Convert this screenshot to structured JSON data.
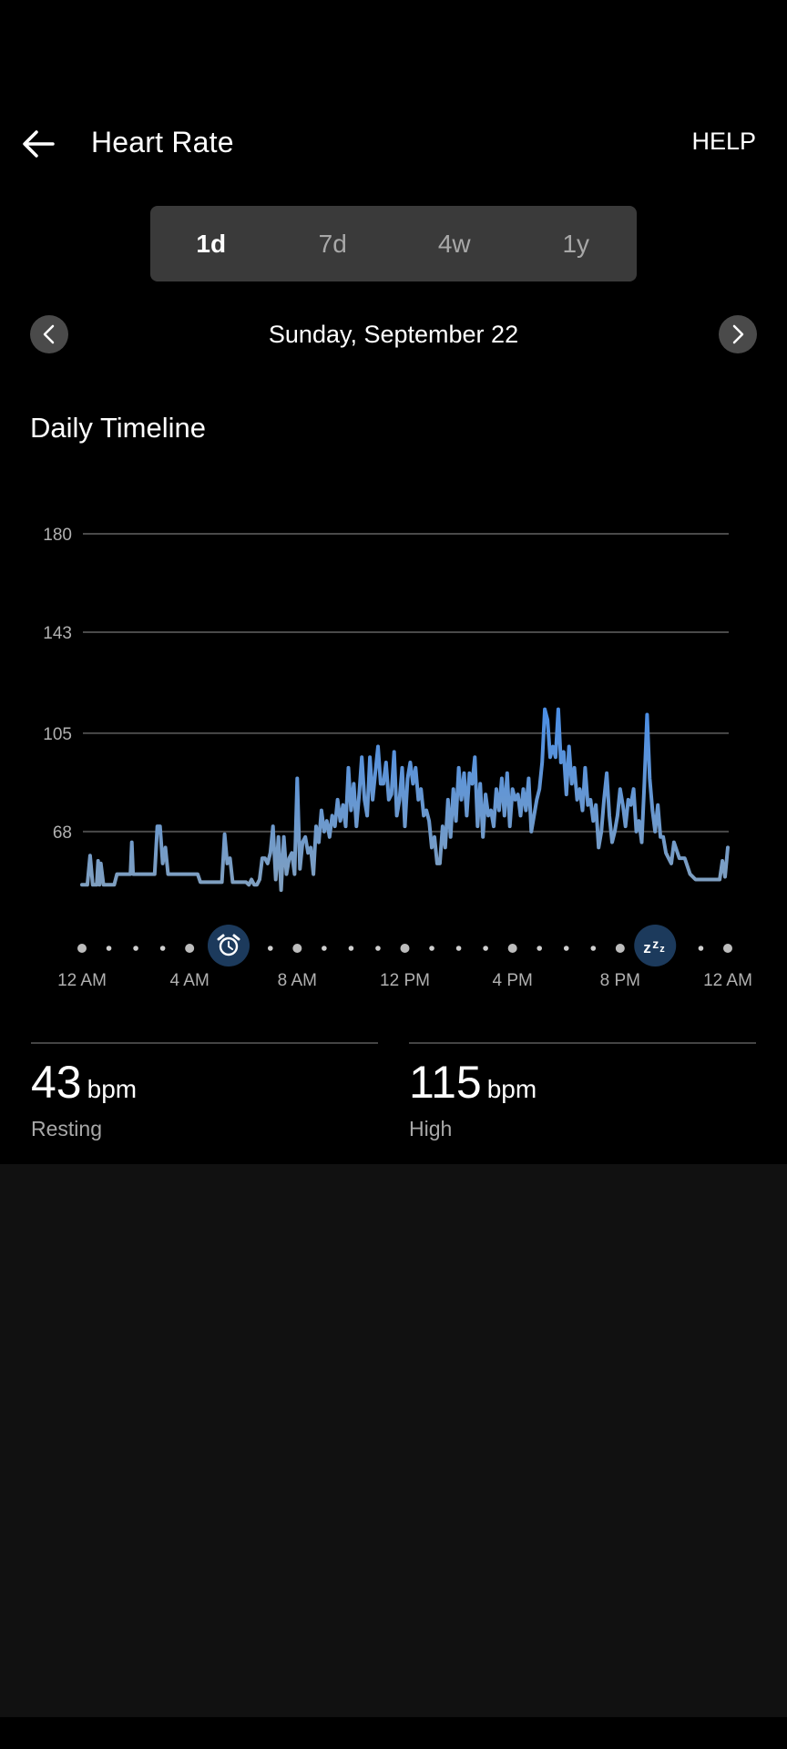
{
  "header": {
    "title": "Heart Rate",
    "help_label": "HELP",
    "back_icon": "arrow-left-icon"
  },
  "range_tabs": [
    {
      "label": "1d",
      "active": true
    },
    {
      "label": "7d",
      "active": false
    },
    {
      "label": "4w",
      "active": false
    },
    {
      "label": "1y",
      "active": false
    }
  ],
  "date_nav": {
    "date": "Sunday, September 22",
    "prev_icon": "chevron-left-icon",
    "next_icon": "chevron-right-icon"
  },
  "section_title": "Daily Timeline",
  "colors": {
    "line_top": "#4a8ee6",
    "line_bottom": "#7f9fc0",
    "grid": "#4a4a4a",
    "marker_bg": "#1c3a5c"
  },
  "chart_data": {
    "type": "line",
    "title": "Daily Timeline",
    "xlabel": "",
    "ylabel": "bpm",
    "ylim": [
      48,
      180
    ],
    "yticks": [
      180,
      143,
      105,
      68
    ],
    "xlim": [
      0,
      24
    ],
    "xtick_labels": [
      "12 AM",
      "4 AM",
      "8 AM",
      "12 PM",
      "4 PM",
      "8 PM",
      "12 AM"
    ],
    "xtick_hours": [
      0,
      4,
      8,
      12,
      16,
      20,
      24
    ],
    "grid": true,
    "markers": [
      {
        "icon": "alarm-clock-icon",
        "label": "wake",
        "hour": 5.45
      },
      {
        "icon": "sleep-zzz-icon",
        "label": "sleep",
        "hour": 21.3
      }
    ],
    "series": [
      {
        "name": "Heart Rate",
        "x": [
          0,
          0.1,
          0.2,
          0.3,
          0.4,
          0.5,
          0.55,
          0.6,
          0.65,
          0.7,
          0.8,
          0.9,
          1.0,
          1.05,
          1.1,
          1.2,
          1.3,
          1.4,
          1.5,
          1.6,
          1.7,
          1.8,
          1.85,
          1.9,
          2.0,
          2.1,
          2.2,
          2.3,
          2.5,
          2.6,
          2.65,
          2.7,
          2.8,
          2.9,
          3.0,
          3.1,
          3.2,
          3.3,
          3.4,
          3.5,
          3.7,
          3.8,
          3.9,
          4.0,
          4.1,
          4.2,
          4.3,
          4.4,
          4.5,
          4.6,
          4.7,
          4.8,
          4.9,
          5.0,
          5.1,
          5.2,
          5.3,
          5.4,
          5.5,
          5.6,
          5.7,
          5.8,
          5.9,
          6.0,
          6.1,
          6.2,
          6.3,
          6.4,
          6.5,
          6.6,
          6.7,
          6.8,
          6.9,
          7.0,
          7.1,
          7.2,
          7.3,
          7.4,
          7.5,
          7.6,
          7.7,
          7.8,
          7.9,
          8.0,
          8.1,
          8.2,
          8.3,
          8.4,
          8.5,
          8.6,
          8.7,
          8.8,
          8.9,
          9.0,
          9.1,
          9.2,
          9.3,
          9.4,
          9.5,
          9.6,
          9.7,
          9.8,
          9.9,
          10.0,
          10.1,
          10.2,
          10.3,
          10.4,
          10.5,
          10.6,
          10.7,
          10.8,
          10.9,
          11.0,
          11.1,
          11.2,
          11.3,
          11.4,
          11.5,
          11.6,
          11.7,
          11.8,
          11.9,
          12.0,
          12.1,
          12.2,
          12.3,
          12.4,
          12.5,
          12.6,
          12.7,
          12.8,
          12.9,
          13.0,
          13.1,
          13.2,
          13.3,
          13.4,
          13.5,
          13.6,
          13.7,
          13.8,
          13.9,
          14.0,
          14.1,
          14.2,
          14.3,
          14.4,
          14.5,
          14.6,
          14.7,
          14.8,
          14.9,
          15.0,
          15.1,
          15.2,
          15.3,
          15.4,
          15.5,
          15.6,
          15.7,
          15.8,
          15.9,
          16.0,
          16.1,
          16.2,
          16.3,
          16.4,
          16.5,
          16.6,
          16.7,
          16.8,
          16.9,
          17.0,
          17.1,
          17.2,
          17.3,
          17.4,
          17.5,
          17.6,
          17.7,
          17.8,
          17.9,
          18.0,
          18.1,
          18.2,
          18.3,
          18.4,
          18.5,
          18.6,
          18.7,
          18.8,
          18.9,
          19.0,
          19.1,
          19.2,
          19.3,
          19.4,
          19.5,
          19.6,
          19.7,
          19.8,
          19.9,
          20.0,
          20.1,
          20.2,
          20.3,
          20.4,
          20.5,
          20.6,
          20.7,
          20.8,
          20.9,
          21.0,
          21.1,
          21.2,
          21.3,
          21.4,
          21.5,
          21.6,
          21.7,
          21.8,
          21.9,
          22.0,
          22.2,
          22.4,
          22.6,
          22.8,
          23.0,
          23.2,
          23.3,
          23.4,
          23.5,
          23.6,
          23.7,
          23.8,
          23.9,
          24.0
        ],
        "y": [
          48,
          48,
          48,
          59,
          48,
          48,
          48,
          57,
          48,
          56,
          48,
          48,
          48,
          48,
          48,
          48,
          52,
          52,
          52,
          52,
          52,
          52,
          64,
          52,
          52,
          52,
          52,
          52,
          52,
          52,
          52,
          52,
          70,
          70,
          56,
          62,
          52,
          52,
          52,
          52,
          52,
          52,
          52,
          52,
          52,
          52,
          52,
          49,
          49,
          49,
          49,
          49,
          49,
          49,
          49,
          49,
          67,
          56,
          58,
          49,
          49,
          49,
          49,
          49,
          49,
          48,
          50,
          48,
          48,
          50,
          58,
          58,
          56,
          60,
          70,
          50,
          66,
          46,
          66,
          52,
          58,
          60,
          52,
          88,
          54,
          64,
          66,
          60,
          62,
          52,
          70,
          64,
          76,
          68,
          72,
          66,
          74,
          70,
          80,
          72,
          78,
          70,
          92,
          76,
          86,
          70,
          82,
          96,
          80,
          74,
          96,
          80,
          90,
          100,
          86,
          86,
          94,
          80,
          82,
          98,
          74,
          80,
          92,
          70,
          88,
          94,
          86,
          92,
          80,
          84,
          74,
          76,
          72,
          62,
          66,
          56,
          56,
          70,
          62,
          80,
          66,
          84,
          72,
          92,
          80,
          90,
          74,
          90,
          86,
          96,
          70,
          86,
          66,
          82,
          74,
          76,
          70,
          84,
          76,
          88,
          74,
          90,
          70,
          84,
          80,
          82,
          74,
          84,
          76,
          88,
          68,
          74,
          80,
          84,
          94,
          114,
          110,
          96,
          100,
          96,
          114,
          94,
          98,
          82,
          100,
          86,
          92,
          80,
          84,
          76,
          92,
          78,
          80,
          72,
          78,
          62,
          68,
          80,
          90,
          74,
          64,
          68,
          74,
          84,
          78,
          70,
          80,
          78,
          84,
          68,
          72,
          64,
          86,
          112,
          88,
          76,
          68,
          78,
          66,
          66,
          60,
          58,
          56,
          64,
          58,
          58,
          52,
          50,
          50,
          50,
          50,
          50,
          50,
          50,
          50,
          57,
          51,
          62,
          50,
          50,
          46
        ]
      }
    ]
  },
  "stats": [
    {
      "value": "43",
      "unit": "bpm",
      "label": "Resting"
    },
    {
      "value": "115",
      "unit": "bpm",
      "label": "High"
    }
  ]
}
